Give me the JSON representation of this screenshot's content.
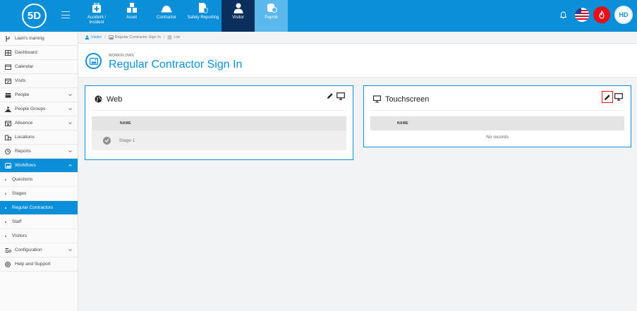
{
  "app": {
    "logo_text": "5D",
    "user_initials": "HD"
  },
  "modules": [
    {
      "label": "Accident / Incident",
      "icon": "first-aid-icon"
    },
    {
      "label": "Asset",
      "icon": "asset-icon"
    },
    {
      "label": "Contractor",
      "icon": "hard-hat-icon"
    },
    {
      "label": "Safety Reporting",
      "icon": "safety-report-icon"
    },
    {
      "label": "Visitor",
      "icon": "person-icon",
      "active": true
    },
    {
      "label": "Payroll",
      "icon": "coins-icon"
    }
  ],
  "sidebar": {
    "items": [
      {
        "label": "Liam's training",
        "icon": "branch-icon"
      },
      {
        "label": "Dashboard",
        "icon": "dashboard-icon"
      },
      {
        "label": "Calendar",
        "icon": "calendar-icon"
      },
      {
        "label": "Visits",
        "icon": "calendar-check-icon"
      },
      {
        "label": "People",
        "icon": "people-icon",
        "expandable": true
      },
      {
        "label": "People Groups",
        "icon": "people-groups-icon",
        "expandable": true
      },
      {
        "label": "Absence",
        "icon": "absence-icon",
        "expandable": true
      },
      {
        "label": "Locations",
        "icon": "building-icon"
      },
      {
        "label": "Reports",
        "icon": "reports-icon",
        "expandable": true
      },
      {
        "label": "Workflows",
        "icon": "workflows-icon",
        "expandable": true,
        "active": true
      }
    ],
    "workflow_subitems": [
      {
        "label": "Questions"
      },
      {
        "label": "Stages"
      },
      {
        "label": "Regular Contractors",
        "active": true
      },
      {
        "label": "Staff"
      },
      {
        "label": "Visitors"
      }
    ],
    "bottom_items": [
      {
        "label": "Configuration",
        "icon": "config-icon",
        "expandable": true
      },
      {
        "label": "Help and Support",
        "icon": "help-icon"
      }
    ]
  },
  "breadcrumb": {
    "items": [
      "Visitor",
      "Regular Contractor Sign In",
      "List"
    ]
  },
  "page": {
    "overline": "WORKFLOWS",
    "title": "Regular Contractor Sign In"
  },
  "cards": {
    "web": {
      "title": "Web",
      "column": "NAME",
      "rows": [
        "Stage 1"
      ]
    },
    "touchscreen": {
      "title": "Touchscreen",
      "column": "NAME",
      "empty_text": "No records"
    }
  },
  "colors": {
    "primary": "#0a8fd8",
    "active_module": "#0b2f5c",
    "highlight": "#e31b1b"
  }
}
